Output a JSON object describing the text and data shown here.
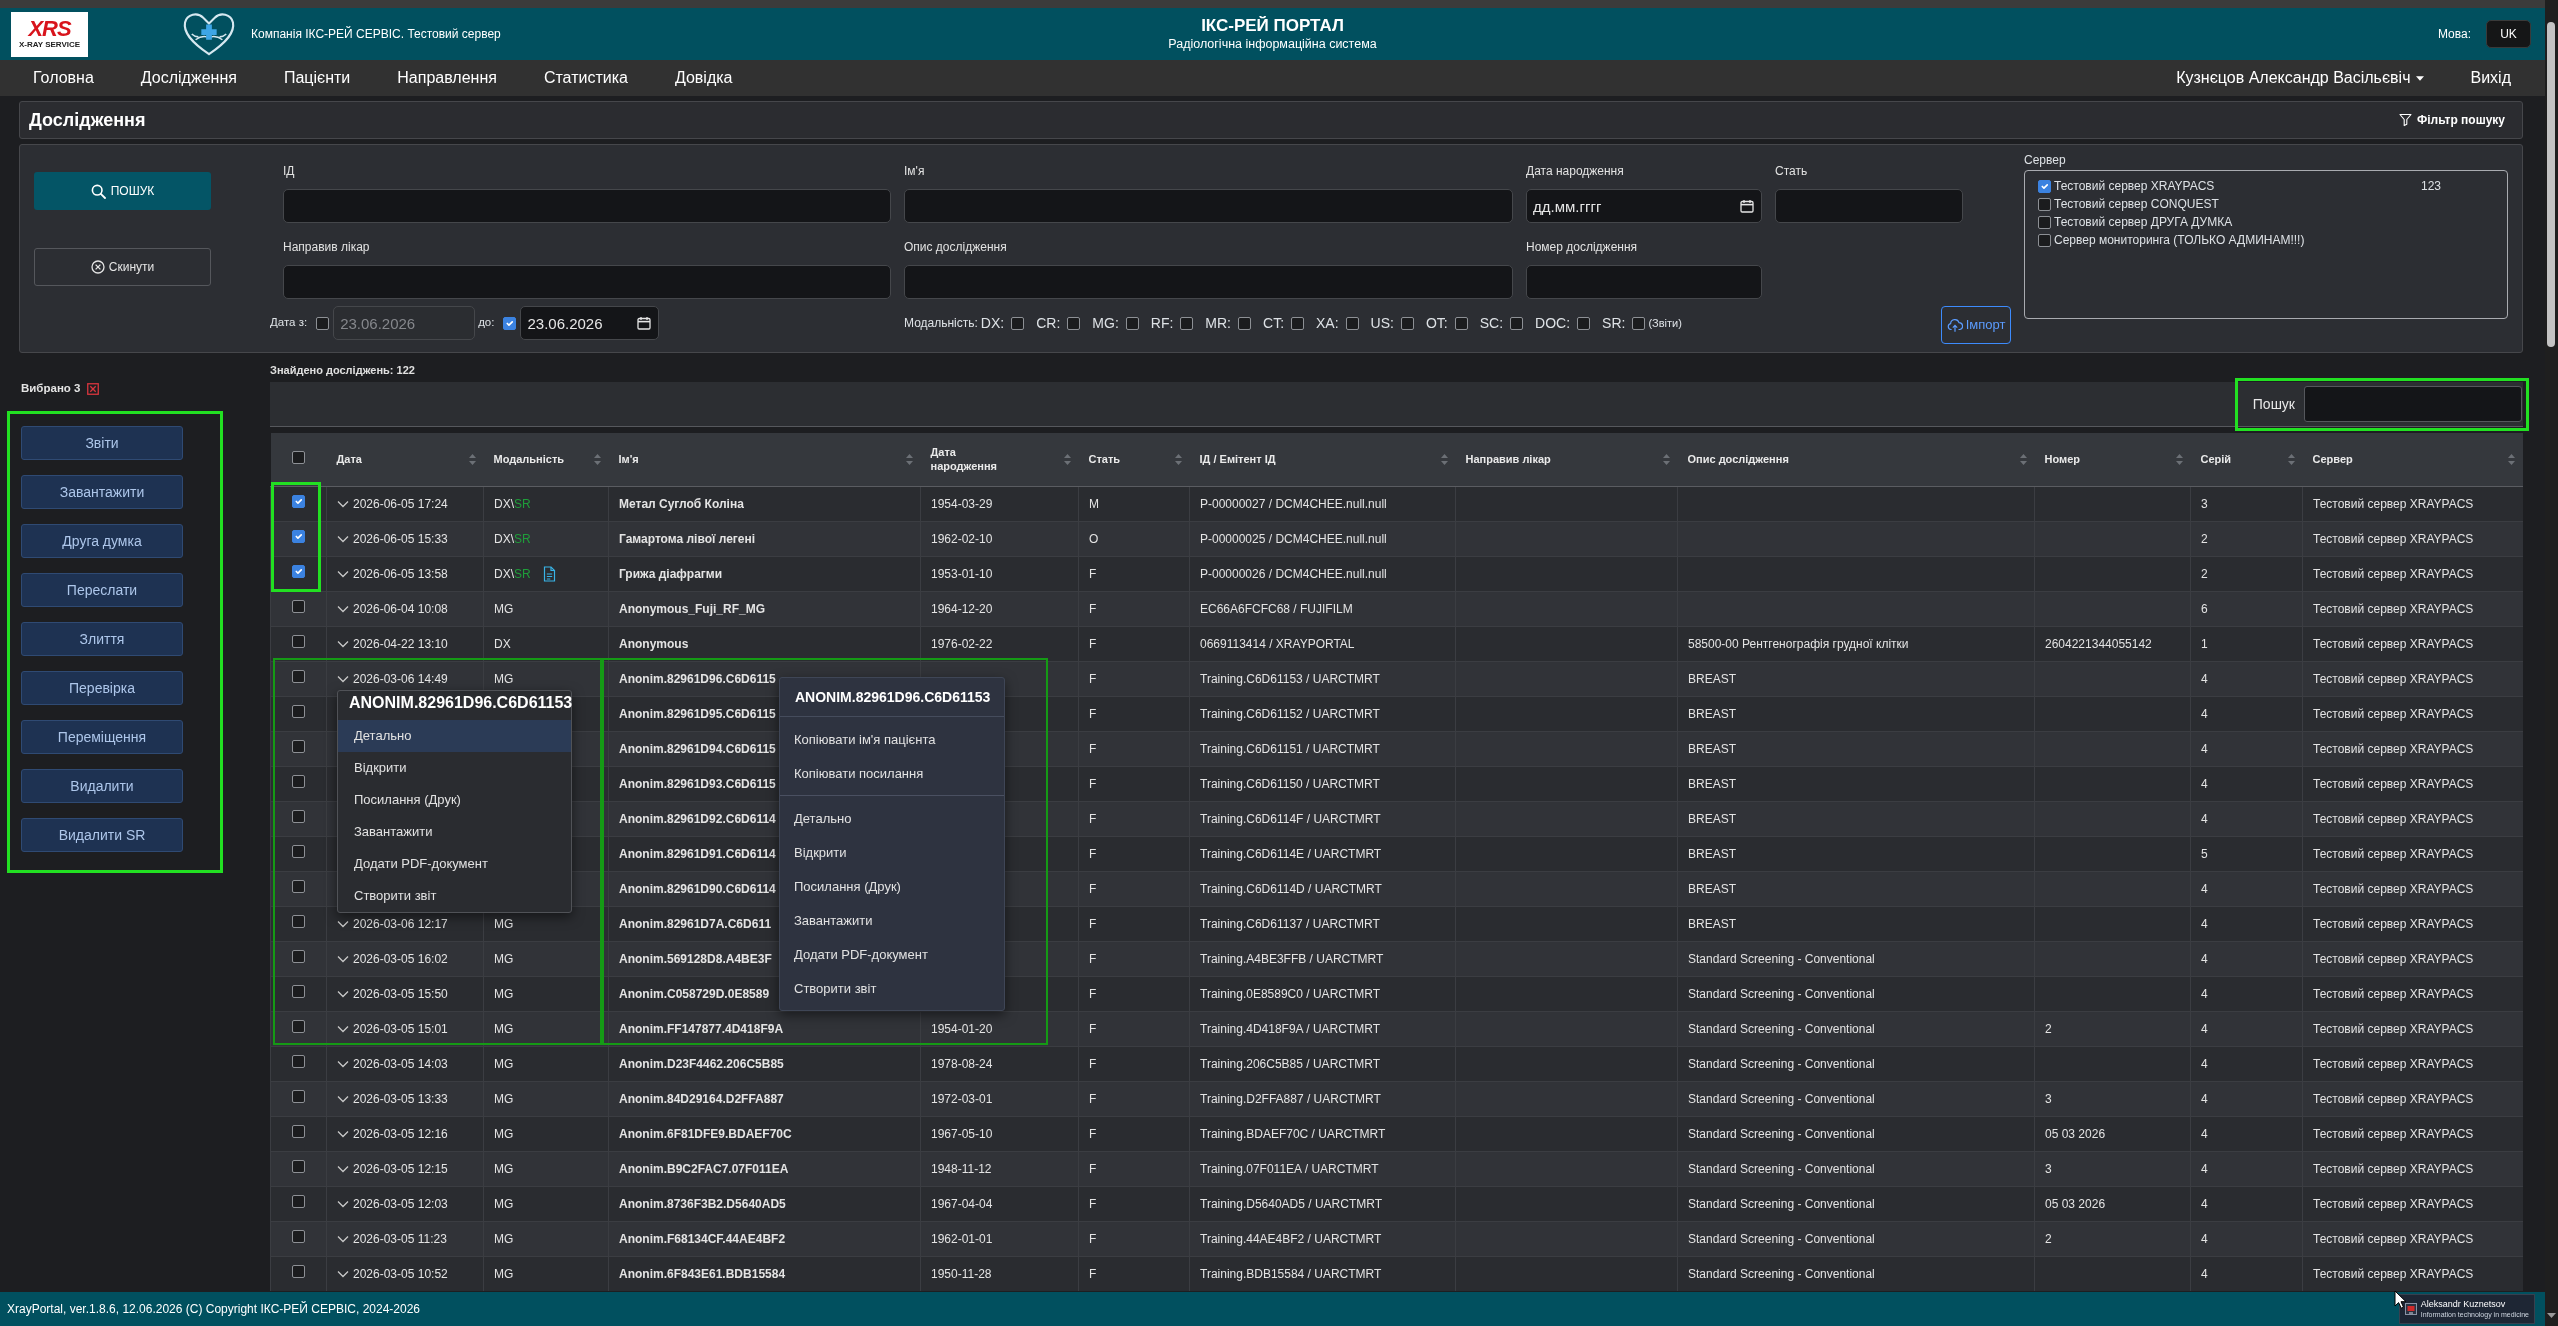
{
  "header": {
    "logo": {
      "mark": "XRS",
      "caption": "X-RAY SERVICE"
    },
    "company": "Компанія ІКС-РЕЙ СЕРВІС. Тестовий сервер",
    "title": "ІКС-РЕЙ ПОРТАЛ",
    "subtitle": "Радіологічна інформаційна система",
    "language_label": "Мова:",
    "language": "UK"
  },
  "nav": {
    "items": [
      "Головна",
      "Дослідження",
      "Пацієнти",
      "Направлення",
      "Статистика",
      "Довідка"
    ],
    "user": "Кузнєцов Александр Васільєвіч",
    "logout": "Вихід"
  },
  "page_title": "Дослідження",
  "filter_toggle": "Фільтр пошуку",
  "filter": {
    "search_button": "ПОШУК",
    "reset_button": "Скинути",
    "fields": [
      {
        "label": "ІД",
        "kind": "text"
      },
      {
        "label": "Ім'я",
        "kind": "text"
      },
      {
        "label": "Дата народження",
        "kind": "date",
        "placeholder": "дд.мм.гггг"
      },
      {
        "label": "Стать",
        "kind": "text"
      },
      {
        "label": "Направив лікар",
        "kind": "text"
      },
      {
        "label": "Опис дослідження",
        "kind": "text"
      },
      {
        "label": "Номер дослідження",
        "kind": "text"
      }
    ],
    "date_range": {
      "from_label": "Дата з:",
      "from_enabled": false,
      "from": "23.06.2026",
      "to_label": "до:",
      "to_enabled": true,
      "to": "23.06.2026"
    },
    "modality_label": "Модальність:",
    "modalities": [
      {
        "label": "DX:",
        "checked": false
      },
      {
        "label": "CR:",
        "checked": false
      },
      {
        "label": "MG:",
        "checked": false
      },
      {
        "label": "RF:",
        "checked": false
      },
      {
        "label": "MR:",
        "checked": false
      },
      {
        "label": "CT:",
        "checked": false
      },
      {
        "label": "XA:",
        "checked": false
      },
      {
        "label": "US:",
        "checked": false
      },
      {
        "label": "OT:",
        "checked": false
      },
      {
        "label": "SC:",
        "checked": false
      },
      {
        "label": "DOC:",
        "checked": false
      },
      {
        "label": "SR:",
        "checked": false
      }
    ],
    "reports_note": "(Звіти)",
    "import_button": "Імпорт",
    "server_label": "Сервер",
    "servers": [
      {
        "label": "Тестовий сервер XRAYPACS",
        "checked": true,
        "count": "123"
      },
      {
        "label": "Тестовий сервер CONQUEST",
        "checked": false
      },
      {
        "label": "Тестовий сервер ДРУГА ДУМКА",
        "checked": false
      },
      {
        "label": "Сервер мониторинга (ТОЛЬКО АДМИНАМ!!!)",
        "checked": false
      }
    ]
  },
  "sidebar": {
    "selection_label": "Вибрано 3",
    "actions": [
      "Звіти",
      "Завантажити",
      "Друга думка",
      "Переслати",
      "Злиття",
      "Перевірка",
      "Переміщення",
      "Видалити",
      "Видалити SR"
    ]
  },
  "table": {
    "found_label": "Знайдено досліджень: 122",
    "search_label": "Пошук",
    "select_all_checked": false,
    "columns": [
      "Дата",
      "Модальність",
      "Ім'я",
      "Дата народження",
      "Стать",
      "ІД / Емітент ІД",
      "Направив лікар",
      "Опис дослідження",
      "Номер",
      "Серій",
      "Сервер"
    ],
    "rows": [
      {
        "checked": true,
        "date": "2026-06-05 17:24",
        "modality": "DX\\",
        "report": "SR",
        "has_document": false,
        "name": "Метал Суглоб Коліна",
        "birth_date": "1954-03-29",
        "sex": "M",
        "patient_id": "P-00000027 / DCM4CHEE.null.null",
        "series": "3",
        "server": "Тестовий сервер XRAYPACS"
      },
      {
        "checked": true,
        "date": "2026-06-05 15:33",
        "modality": "DX\\",
        "report": "SR",
        "has_document": false,
        "name": "Гамартома лівої легені",
        "birth_date": "1962-02-10",
        "sex": "O",
        "patient_id": "P-00000025 / DCM4CHEE.null.null",
        "series": "2",
        "server": "Тестовий сервер XRAYPACS"
      },
      {
        "checked": true,
        "date": "2026-06-05 13:58",
        "modality": "DX\\",
        "report": "SR",
        "has_document": true,
        "name": "Грижа діафрагми",
        "birth_date": "1953-01-10",
        "sex": "F",
        "patient_id": "P-00000026 / DCM4CHEE.null.null",
        "series": "2",
        "server": "Тестовий сервер XRAYPACS"
      },
      {
        "checked": false,
        "date": "2026-06-04 10:08",
        "modality": "MG",
        "has_document": false,
        "name": "Anonymous_Fuji_RF_MG",
        "birth_date": "1964-12-20",
        "sex": "F",
        "patient_id": "EC66A6FCFC68 / FUJIFILM",
        "series": "6",
        "server": "Тестовий сервер XRAYPACS"
      },
      {
        "checked": false,
        "date": "2026-04-22 13:10",
        "modality": "DX",
        "has_document": false,
        "name": "Anonymous",
        "birth_date": "1976-02-22",
        "sex": "F",
        "patient_id": "0669113414 / XRAYPORTAL",
        "description": "58500-00 Рентгенографія грудної клітки",
        "number": "2604221344055142",
        "series": "1",
        "server": "Тестовий сервер XRAYPACS"
      },
      {
        "checked": false,
        "date": "2026-03-06 14:49",
        "modality": "MG",
        "has_document": false,
        "name": "Anonim.82961D96.C6D6115",
        "sex": "F",
        "patient_id": "Training.C6D61153 / UARCTMRT",
        "description": "BREAST",
        "series": "4",
        "server": "Тестовий сервер XRAYPACS"
      },
      {
        "checked": false,
        "name": "Anonim.82961D95.C6D6115",
        "sex": "F",
        "patient_id": "Training.C6D61152 / UARCTMRT",
        "description": "BREAST",
        "series": "4",
        "server": "Тестовий сервер XRAYPACS"
      },
      {
        "checked": false,
        "name": "Anonim.82961D94.C6D6115",
        "sex": "F",
        "patient_id": "Training.C6D61151 / UARCTMRT",
        "description": "BREAST",
        "series": "4",
        "server": "Тестовий сервер XRAYPACS"
      },
      {
        "checked": false,
        "name": "Anonim.82961D93.C6D6115",
        "sex": "F",
        "patient_id": "Training.C6D61150 / UARCTMRT",
        "description": "BREAST",
        "series": "4",
        "server": "Тестовий сервер XRAYPACS"
      },
      {
        "checked": false,
        "name": "Anonim.82961D92.C6D6114",
        "sex": "F",
        "patient_id": "Training.C6D6114F / UARCTMRT",
        "description": "BREAST",
        "series": "4",
        "server": "Тестовий сервер XRAYPACS"
      },
      {
        "checked": false,
        "name": "Anonim.82961D91.C6D6114",
        "sex": "F",
        "patient_id": "Training.C6D6114E / UARCTMRT",
        "description": "BREAST",
        "series": "5",
        "server": "Тестовий сервер XRAYPACS"
      },
      {
        "checked": false,
        "name": "Anonim.82961D90.C6D6114",
        "sex": "F",
        "patient_id": "Training.C6D6114D / UARCTMRT",
        "description": "BREAST",
        "series": "4",
        "server": "Тестовий сервер XRAYPACS"
      },
      {
        "checked": false,
        "date": "2026-03-06 12:17",
        "modality": "MG",
        "has_document": false,
        "name": "Anonim.82961D7A.C6D611",
        "sex": "F",
        "patient_id": "Training.C6D61137 / UARCTMRT",
        "description": "BREAST",
        "series": "4",
        "server": "Тестовий сервер XRAYPACS"
      },
      {
        "checked": false,
        "date": "2026-03-05 16:02",
        "modality": "MG",
        "has_document": false,
        "name": "Anonim.569128D8.A4BE3F",
        "sex": "F",
        "patient_id": "Training.A4BE3FFB / UARCTMRT",
        "description": "Standard Screening - Conventional",
        "series": "4",
        "server": "Тестовий сервер XRAYPACS"
      },
      {
        "checked": false,
        "date": "2026-03-05 15:50",
        "modality": "MG",
        "has_document": false,
        "name": "Anonim.C058729D.0E8589",
        "sex": "F",
        "patient_id": "Training.0E8589C0 / UARCTMRT",
        "description": "Standard Screening - Conventional",
        "series": "4",
        "server": "Тестовий сервер XRAYPACS"
      },
      {
        "checked": false,
        "date": "2026-03-05 15:01",
        "modality": "MG",
        "has_document": false,
        "name": "Anonim.FF147877.4D418F9A",
        "birth_date": "1954-01-20",
        "sex": "F",
        "patient_id": "Training.4D418F9A / UARCTMRT",
        "description": "Standard Screening - Conventional",
        "number": "2",
        "series": "4",
        "server": "Тестовий сервер XRAYPACS"
      },
      {
        "checked": false,
        "date": "2026-03-05 14:03",
        "modality": "MG",
        "has_document": false,
        "name": "Anonim.D23F4462.206C5B85",
        "birth_date": "1978-08-24",
        "sex": "F",
        "patient_id": "Training.206C5B85 / UARCTMRT",
        "description": "Standard Screening - Conventional",
        "series": "4",
        "server": "Тестовий сервер XRAYPACS"
      },
      {
        "checked": false,
        "date": "2026-03-05 13:33",
        "modality": "MG",
        "has_document": false,
        "name": "Anonim.84D29164.D2FFA887",
        "birth_date": "1972-03-01",
        "sex": "F",
        "patient_id": "Training.D2FFA887 / UARCTMRT",
        "description": "Standard Screening - Conventional",
        "number": "3",
        "series": "4",
        "server": "Тестовий сервер XRAYPACS"
      },
      {
        "checked": false,
        "date": "2026-03-05 12:16",
        "modality": "MG",
        "has_document": false,
        "name": "Anonim.6F81DFE9.BDAEF70C",
        "birth_date": "1967-05-10",
        "sex": "F",
        "patient_id": "Training.BDAEF70C / UARCTMRT",
        "description": "Standard Screening - Conventional",
        "number": "05 03 2026",
        "series": "4",
        "server": "Тестовий сервер XRAYPACS"
      },
      {
        "checked": false,
        "date": "2026-03-05 12:15",
        "modality": "MG",
        "has_document": false,
        "name": "Anonim.B9C2FAC7.07F011EA",
        "birth_date": "1948-11-12",
        "sex": "F",
        "patient_id": "Training.07F011EA / UARCTMRT",
        "description": "Standard Screening - Conventional",
        "number": "3",
        "series": "4",
        "server": "Тестовий сервер XRAYPACS"
      },
      {
        "checked": false,
        "date": "2026-03-05 12:03",
        "modality": "MG",
        "has_document": false,
        "name": "Anonim.8736F3B2.D5640AD5",
        "birth_date": "1967-04-04",
        "sex": "F",
        "patient_id": "Training.D5640AD5 / UARCTMRT",
        "description": "Standard Screening - Conventional",
        "number": "05 03 2026",
        "series": "4",
        "server": "Тестовий сервер XRAYPACS"
      },
      {
        "checked": false,
        "date": "2026-03-05 11:23",
        "modality": "MG",
        "has_document": false,
        "name": "Anonim.F68134CF.44AE4BF2",
        "birth_date": "1962-01-01",
        "sex": "F",
        "patient_id": "Training.44AE4BF2 / UARCTMRT",
        "description": "Standard Screening - Conventional",
        "number": "2",
        "series": "4",
        "server": "Тестовий сервер XRAYPACS"
      },
      {
        "checked": false,
        "date": "2026-03-05 10:52",
        "modality": "MG",
        "has_document": false,
        "name": "Anonim.6F843E61.BDB15584",
        "birth_date": "1950-11-28",
        "sex": "F",
        "patient_id": "Training.BDB15584 / UARCTMRT",
        "description": "Standard Screening - Conventional",
        "series": "4",
        "server": "Тестовий сервер XRAYPACS"
      }
    ]
  },
  "context_menus": [
    {
      "title": "ANONIM.82961D96.C6D61153",
      "groups": [
        [
          {
            "label": "Детально",
            "selected": true
          },
          {
            "label": "Відкрити",
            "selected": false
          },
          {
            "label": "Посилання (Друк)",
            "selected": false
          },
          {
            "label": "Завантажити",
            "selected": false
          },
          {
            "label": "Додати PDF-документ",
            "selected": false
          },
          {
            "label": "Створити звіт",
            "selected": false
          }
        ]
      ]
    },
    {
      "title": "ANONIM.82961D96.C6D61153",
      "groups": [
        [
          {
            "label": "Копіювати ім'я пацієнта",
            "selected": false
          },
          {
            "label": "Копіювати посилання",
            "selected": false
          }
        ],
        [
          {
            "label": "Детально",
            "selected": false
          },
          {
            "label": "Відкрити",
            "selected": false
          },
          {
            "label": "Посилання (Друк)",
            "selected": false
          },
          {
            "label": "Завантажити",
            "selected": false
          },
          {
            "label": "Додати PDF-документ",
            "selected": false
          },
          {
            "label": "Створити звіт",
            "selected": false
          }
        ]
      ]
    }
  ],
  "footer": {
    "text": "XrayPortal, ver.1.8.6, 12.06.2026 (C) Copyright ІКС-РЕЙ СЕРВІС, 2024-2026",
    "badge": {
      "name": "Aleksandr Kuznetsov",
      "tagline": "Information technology in medicine"
    }
  }
}
